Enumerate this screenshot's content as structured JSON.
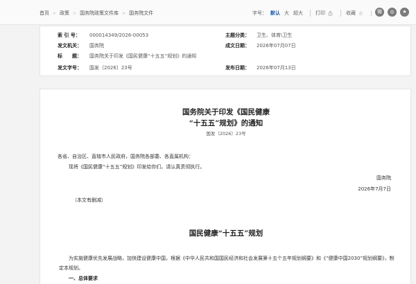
{
  "breadcrumb": {
    "items": [
      "首页",
      "政策",
      "国务院政策文件库",
      "国务院文件"
    ],
    "separator": ">"
  },
  "toolbar": {
    "font_size_label": "字号：",
    "font_sizes": [
      "默认",
      "大",
      "超大"
    ],
    "active_font_size": "默认",
    "print_label": "打印",
    "favorite_label": "收藏",
    "share_icons": [
      "weibo-icon",
      "wechat-icon",
      "qzone-icon"
    ]
  },
  "meta": {
    "index_label": "索 引 号：",
    "index_value": "000014349/2026-00053",
    "category_label": "主题分类：",
    "category_value": "卫生、体育\\卫生",
    "issuer_label": "发文机关：",
    "issuer_value": "国务院",
    "created_label": "成文日期：",
    "created_value": "2026年07月07日",
    "title_label": "标　　题：",
    "title_value": "国务院关于印发《国民健康“十五五”规划》的通知",
    "docno_label": "发文字号：",
    "docno_value": "国发〔2026〕23号",
    "published_label": "发布日期：",
    "published_value": "2026年07月13日"
  },
  "article": {
    "title_line1": "国务院关于印发《国民健康",
    "title_line2": "“十五五”规划》的通知",
    "doc_number": "国发〔2026〕23号",
    "addressee": "各省、自治区、直辖市人民政府，国务院各部委、各直属机构：",
    "body": "现将《国民健康“十五五”规划》印发给你们，请认真贯彻执行。",
    "signer": "国务院",
    "date": "2026年7月7日",
    "note": "（本文有删减）",
    "plan_title": "国民健康“十五五”规划",
    "plan_intro": "为实施健康优先发展战略，加快建设健康中国，根据《中华人民共和国国民经济和社会发展第十五个五年规划纲要》和《“健康中国2030”规划纲要》，制定本规划。",
    "section1": "一、总体要求"
  },
  "colors": {
    "accent": "#1a5fb4",
    "share_icon": "#7a7a7a"
  }
}
